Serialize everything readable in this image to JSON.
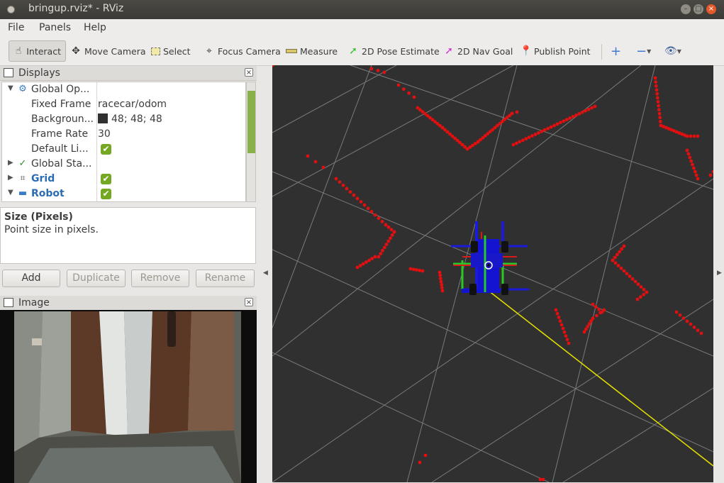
{
  "window": {
    "title": "bringup.rviz* - RViz"
  },
  "menu": {
    "file": "File",
    "panels": "Panels",
    "help": "Help"
  },
  "toolbar": {
    "interact": "Interact",
    "move_camera": "Move Camera",
    "select": "Select",
    "focus_camera": "Focus Camera",
    "measure": "Measure",
    "pose_estimate": "2D Pose Estimate",
    "nav_goal": "2D Nav Goal",
    "publish_point": "Publish Point"
  },
  "displays": {
    "title": "Displays",
    "rows": [
      {
        "label": "Global Op...",
        "value": ""
      },
      {
        "label": "Fixed Frame",
        "value": "racecar/odom"
      },
      {
        "label": "Backgroun...",
        "value": "48; 48; 48"
      },
      {
        "label": "Frame Rate",
        "value": "30"
      },
      {
        "label": "Default Li...",
        "value": ""
      },
      {
        "label": "Global Sta...",
        "value": ""
      },
      {
        "label": "Grid",
        "value": ""
      },
      {
        "label": "Robot",
        "value": ""
      }
    ],
    "background_color": "#303030"
  },
  "description": {
    "title": "Size (Pixels)",
    "text": "Point size in pixels."
  },
  "buttons": {
    "add": "Add",
    "duplicate": "Duplicate",
    "remove": "Remove",
    "rename": "Rename"
  },
  "image_panel": {
    "title": "Image"
  },
  "colors": {
    "laser_points": "#e01010",
    "grid": "#7a7a7a",
    "path": "#e4e000",
    "viewport_bg": "#303030"
  }
}
